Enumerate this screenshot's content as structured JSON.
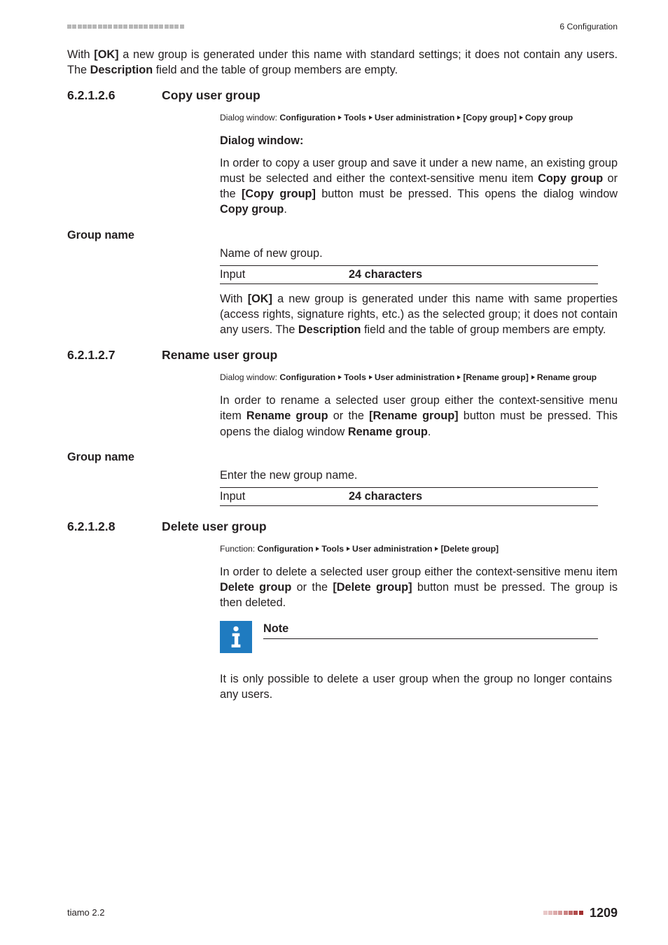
{
  "header": {
    "right": "6 Configuration"
  },
  "intro": {
    "p1_a": "With ",
    "p1_ok": "[OK]",
    "p1_b": " a new group is generated under this name with standard settings; it does not contain any users. The ",
    "p1_desc": "Description",
    "p1_c": " field and the table of group members are empty."
  },
  "s6": {
    "num": "6.2.1.2.6",
    "title": "Copy user group",
    "crumb": {
      "pre": "Dialog window: ",
      "c1": "Configuration",
      "c2": "Tools",
      "c3": "User administration",
      "c4": "[Copy group]",
      "c5": "Copy group"
    },
    "dw": "Dialog window:",
    "p1_a": "In order to copy a user group and save it under a new name, an existing group must be selected and either the context-sensitive menu item ",
    "p1_b": "Copy group",
    "p1_c": " or the ",
    "p1_d": "[Copy group]",
    "p1_e": " button must be pressed. This opens the dialog window ",
    "p1_f": "Copy group",
    "p1_g": ".",
    "gn_label": "Group name",
    "gn_desc": "Name of new group.",
    "input_k": "Input",
    "input_v": "24 characters",
    "p2_a": "With ",
    "p2_ok": "[OK]",
    "p2_b": " a new group is generated under this name with same properties (access rights, signature rights, etc.) as the selected group; it does not contain any users. The ",
    "p2_desc": "Description",
    "p2_c": " field and the table of group members are empty."
  },
  "s7": {
    "num": "6.2.1.2.7",
    "title": "Rename user group",
    "crumb": {
      "pre": "Dialog window: ",
      "c1": "Configuration",
      "c2": "Tools",
      "c3": "User administration",
      "c4": "[Rename group]",
      "c5": "Rename group"
    },
    "p1_a": "In order to rename a selected user group either the context-sensitive menu item ",
    "p1_b": "Rename group",
    "p1_c": " or the ",
    "p1_d": "[Rename group]",
    "p1_e": " button must be pressed. This opens the dialog window ",
    "p1_f": "Rename group",
    "p1_g": ".",
    "gn_label": "Group name",
    "gn_desc": "Enter the new group name.",
    "input_k": "Input",
    "input_v": "24 characters"
  },
  "s8": {
    "num": "6.2.1.2.8",
    "title": "Delete user group",
    "crumb": {
      "pre": "Function: ",
      "c1": "Configuration",
      "c2": "Tools",
      "c3": "User administration",
      "c4": "[Delete group]"
    },
    "p1_a": "In order to delete a selected user group either the context-sensitive menu item ",
    "p1_b": "Delete group",
    "p1_c": " or the ",
    "p1_d": "[Delete group]",
    "p1_e": " button must be pressed. The group is then deleted.",
    "note_title": "Note",
    "note_text": "It is only possible to delete a user group when the group no longer contains any users."
  },
  "footer": {
    "left": "tiamo 2.2",
    "page": "1209"
  }
}
